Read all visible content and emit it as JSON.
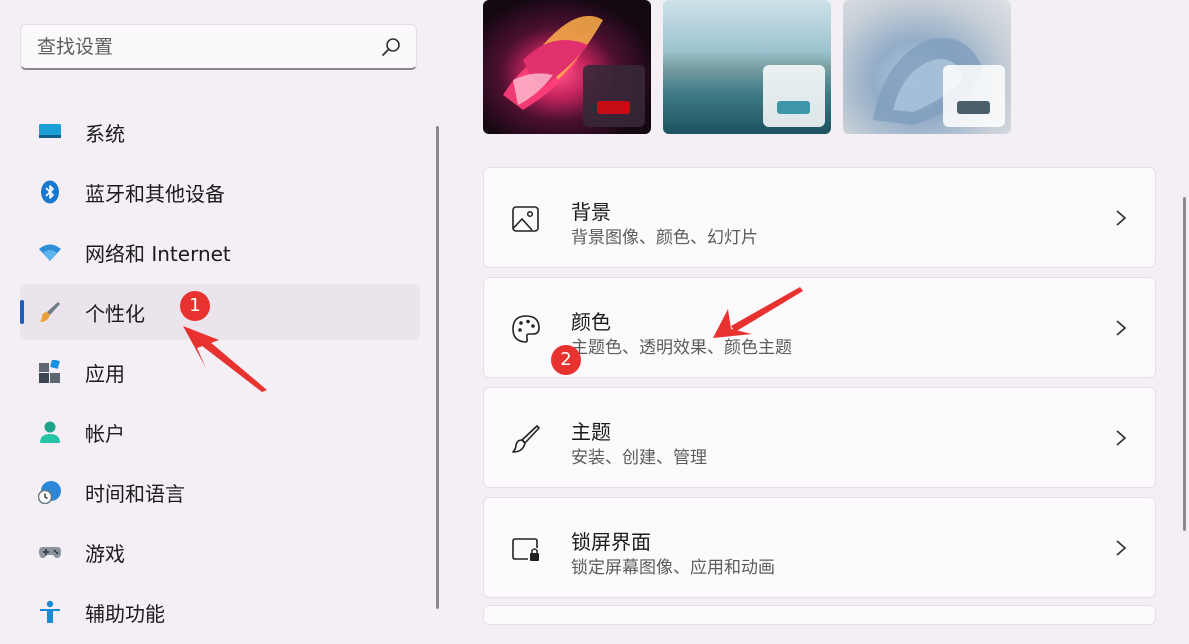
{
  "search": {
    "placeholder": "查找设置",
    "icon": "search-icon"
  },
  "sidebar": {
    "items": [
      {
        "label": "系统",
        "icon": "monitor-icon",
        "active": false
      },
      {
        "label": "蓝牙和其他设备",
        "icon": "bluetooth-icon",
        "active": false
      },
      {
        "label": "网络和 Internet",
        "icon": "wifi-icon",
        "active": false
      },
      {
        "label": "个性化",
        "icon": "paintbrush-icon",
        "active": true
      },
      {
        "label": "应用",
        "icon": "apps-icon",
        "active": false
      },
      {
        "label": "帐户",
        "icon": "person-icon",
        "active": false
      },
      {
        "label": "时间和语言",
        "icon": "globe-clock-icon",
        "active": false
      },
      {
        "label": "游戏",
        "icon": "gamepad-icon",
        "active": false
      },
      {
        "label": "辅助功能",
        "icon": "accessibility-icon",
        "active": false
      }
    ]
  },
  "themes": [
    {
      "name": "theme-bloom",
      "accent": "#c80c13"
    },
    {
      "name": "theme-lake",
      "accent": "#3e95a8"
    },
    {
      "name": "theme-glow",
      "accent": "#4b5e6c"
    }
  ],
  "cards": [
    {
      "title": "背景",
      "subtitle": "背景图像、颜色、幻灯片",
      "icon": "image-icon"
    },
    {
      "title": "颜色",
      "subtitle": "主题色、透明效果、颜色主题",
      "icon": "palette-icon"
    },
    {
      "title": "主题",
      "subtitle": "安装、创建、管理",
      "icon": "brush-icon"
    },
    {
      "title": "锁屏界面",
      "subtitle": "锁定屏幕图像、应用和动画",
      "icon": "lock-screen-icon"
    }
  ],
  "annotations": [
    {
      "number": "1"
    },
    {
      "number": "2"
    }
  ],
  "colors": {
    "accent": "#1f5fb8",
    "annotation": "#e8322f",
    "background": "#f4eef5"
  }
}
